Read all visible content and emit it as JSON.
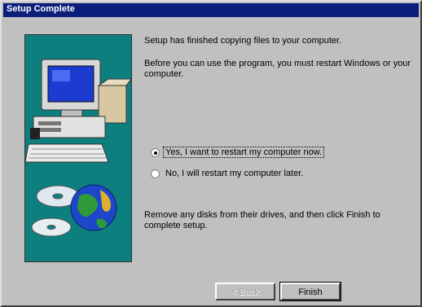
{
  "window": {
    "title": "Setup Complete"
  },
  "message": {
    "line1": "Setup has finished copying files to your computer.",
    "line2": "Before you can use the program, you must restart Windows or your computer."
  },
  "options": [
    {
      "label": "Yes, I want to restart my computer now.",
      "selected": true
    },
    {
      "label": "No, I will restart my computer later.",
      "selected": false
    }
  ],
  "instructions": "Remove any disks from their drives, and then click Finish to complete setup.",
  "buttons": {
    "back": "< Back",
    "finish": "Finish"
  },
  "colors": {
    "titlebar": "#0a1e7a",
    "panel": "#0e7f7f",
    "face": "#c0c0c0"
  }
}
